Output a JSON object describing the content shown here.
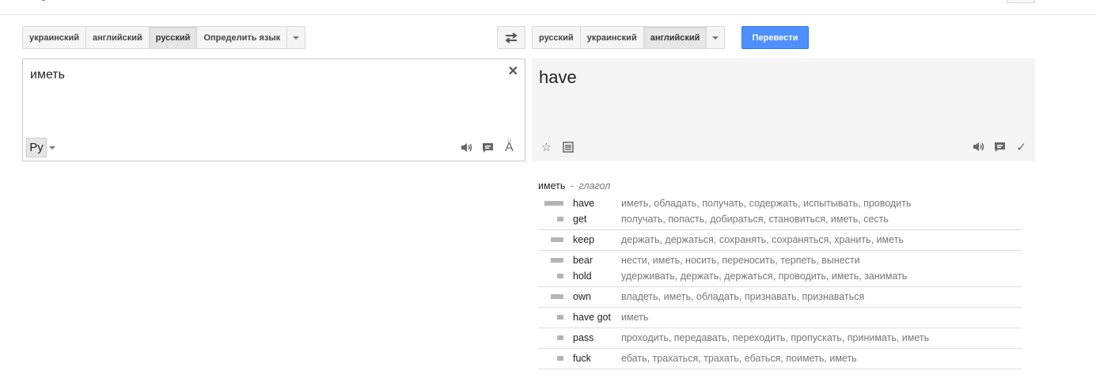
{
  "source_langs": {
    "items": [
      "украинский",
      "английский",
      "русский",
      "Определить язык"
    ],
    "selected_index": 2
  },
  "target_langs": {
    "items": [
      "русский",
      "украинский",
      "английский"
    ],
    "selected_index": 2
  },
  "translate_button": "Перевести",
  "source": {
    "text": "иметь",
    "ime_label": "Ру",
    "icons": [
      "speaker-icon",
      "feedback-icon",
      "virtual-keyboard-icon"
    ]
  },
  "target": {
    "text": "have",
    "icons": [
      "star-icon",
      "list-icon",
      "speaker-icon",
      "feedback-icon",
      "check-icon"
    ]
  },
  "dictionary": {
    "headword": "иметь",
    "separator": "-",
    "part_of_speech": "глагол",
    "groups": [
      [
        {
          "word": "have",
          "frequency": "high",
          "translations": "иметь, обладать, получать, содержать, испытывать, проводить"
        },
        {
          "word": "get",
          "frequency": "low",
          "translations": "получать, попасть, добираться, становиться, иметь, сесть"
        }
      ],
      [
        {
          "word": "keep",
          "frequency": "medium",
          "translations": "держать, держаться, сохранять, сохраняться, хранить, иметь"
        }
      ],
      [
        {
          "word": "bear",
          "frequency": "medium",
          "translations": "нести, иметь, носить, переносить, терпеть, вынести"
        },
        {
          "word": "hold",
          "frequency": "low",
          "translations": "удерживать, держать, держаться, проводить, иметь, занимать"
        }
      ],
      [
        {
          "word": "own",
          "frequency": "medium",
          "translations": "владеть, иметь, обладать, признавать, признаваться"
        }
      ],
      [
        {
          "word": "have got",
          "frequency": "low",
          "translations": "иметь"
        }
      ],
      [
        {
          "word": "pass",
          "frequency": "low",
          "translations": "проходить, передавать, переходить, пропускать, принимать, иметь"
        }
      ],
      [
        {
          "word": "fuck",
          "frequency": "low",
          "translations": "ебать, трахаться, трахать, ебаться, поиметь, иметь"
        }
      ]
    ]
  },
  "colors": {
    "accent": "#4d90fe",
    "frequency_bar": "#b5b5b5",
    "target_bg": "#f5f5f5"
  }
}
